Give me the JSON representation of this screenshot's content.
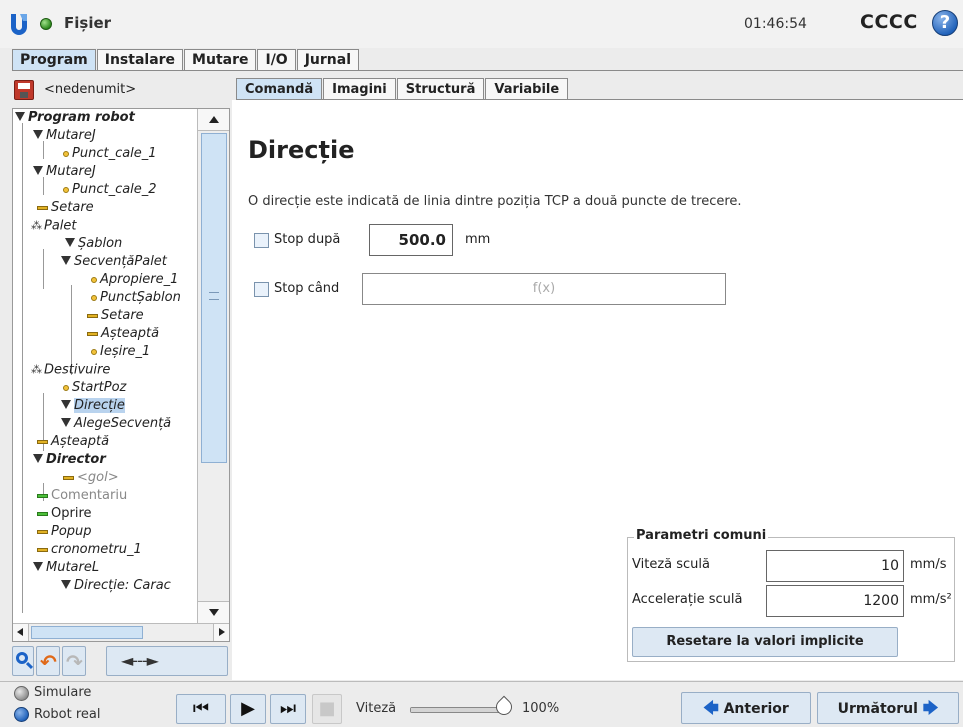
{
  "header": {
    "file_menu": "Fișier",
    "clock": "01:46:54",
    "robot_name": "CCCC",
    "help_glyph": "?",
    "status_color": "#3aa02a"
  },
  "main_tabs": [
    "Program",
    "Instalare",
    "Mutare",
    "I/O",
    "Jurnal"
  ],
  "active_main_tab": "Program",
  "program": {
    "name": "<nedenumit>"
  },
  "tree": {
    "nodes": [
      {
        "label": "Program robot",
        "icon": "triangle-icon"
      },
      {
        "label": "MutareJ",
        "icon": "triangle-icon"
      },
      {
        "label": "Punct_cale_1",
        "icon": "waypoint-icon"
      },
      {
        "label": "MutareJ",
        "icon": "triangle-icon"
      },
      {
        "label": "Punct_cale_2",
        "icon": "waypoint-icon"
      },
      {
        "label": "Setare",
        "icon": "dash-icon"
      },
      {
        "label": "Palet",
        "icon": "pallet-icon"
      },
      {
        "label": "Șablon",
        "icon": "triangle-icon"
      },
      {
        "label": "SecvențăPalet",
        "icon": "triangle-icon"
      },
      {
        "label": "Apropiere_1",
        "icon": "waypoint-icon"
      },
      {
        "label": "PunctȘablon",
        "icon": "waypoint-icon"
      },
      {
        "label": "Setare",
        "icon": "dash-icon"
      },
      {
        "label": "Așteaptă",
        "icon": "dash-icon"
      },
      {
        "label": "Ieșire_1",
        "icon": "waypoint-icon"
      },
      {
        "label": "Destivuire",
        "icon": "pallet-icon"
      },
      {
        "label": "StartPoz",
        "icon": "waypoint-icon"
      },
      {
        "label": "Direcție",
        "icon": "triangle-icon"
      },
      {
        "label": "AlegeSecvență",
        "icon": "triangle-icon"
      },
      {
        "label": "Așteaptă",
        "icon": "dash-icon"
      },
      {
        "label": "Director",
        "icon": "triangle-icon"
      },
      {
        "label": "<gol>",
        "icon": "dash-icon"
      },
      {
        "label": "Comentariu",
        "icon": "dash-icon"
      },
      {
        "label": "Oprire",
        "icon": "dash-icon"
      },
      {
        "label": "Popup",
        "icon": "dash-icon"
      },
      {
        "label": "cronometru_1",
        "icon": "dash-icon"
      },
      {
        "label": "MutareL",
        "icon": "triangle-icon"
      },
      {
        "label": "Direcție: Carac",
        "icon": "triangle-icon"
      }
    ],
    "selected": "Direcție"
  },
  "toolbar": {
    "search_icon": "search-icon",
    "undo_icon": "undo-icon",
    "redo_icon": "redo-icon",
    "move_label": "◄---►"
  },
  "sub_tabs": [
    "Comandă",
    "Imagini",
    "Structură",
    "Variabile"
  ],
  "active_sub_tab": "Comandă",
  "command": {
    "title": "Direcție",
    "description": "O direcție este indicată de linia dintre poziția TCP a două puncte de trecere.",
    "stop_after": {
      "label": "Stop după",
      "value": "500.0",
      "unit": "mm",
      "checked": false
    },
    "stop_when": {
      "label": "Stop când",
      "placeholder": "f(x)",
      "checked": false
    }
  },
  "params": {
    "legend": "Parametri comuni",
    "tool_speed": {
      "label": "Viteză sculă",
      "value": "10",
      "unit": "mm/s"
    },
    "tool_accel": {
      "label": "Accelerație sculă",
      "value": "1200",
      "unit": "mm/s²"
    },
    "reset_label": "Resetare la valori implicite"
  },
  "footer": {
    "simulation_label": "Simulare",
    "real_robot_label": "Robot real",
    "selected_mode": "Robot real",
    "speed_label": "Viteză",
    "speed_value": "100%",
    "speed_fraction": 1.0,
    "prev_label": "Anterior",
    "next_label": "Următorul"
  },
  "colors": {
    "accent": "#1c63c7",
    "tab_active": "#cfe3f5",
    "button_bg": "#dde8f3"
  }
}
